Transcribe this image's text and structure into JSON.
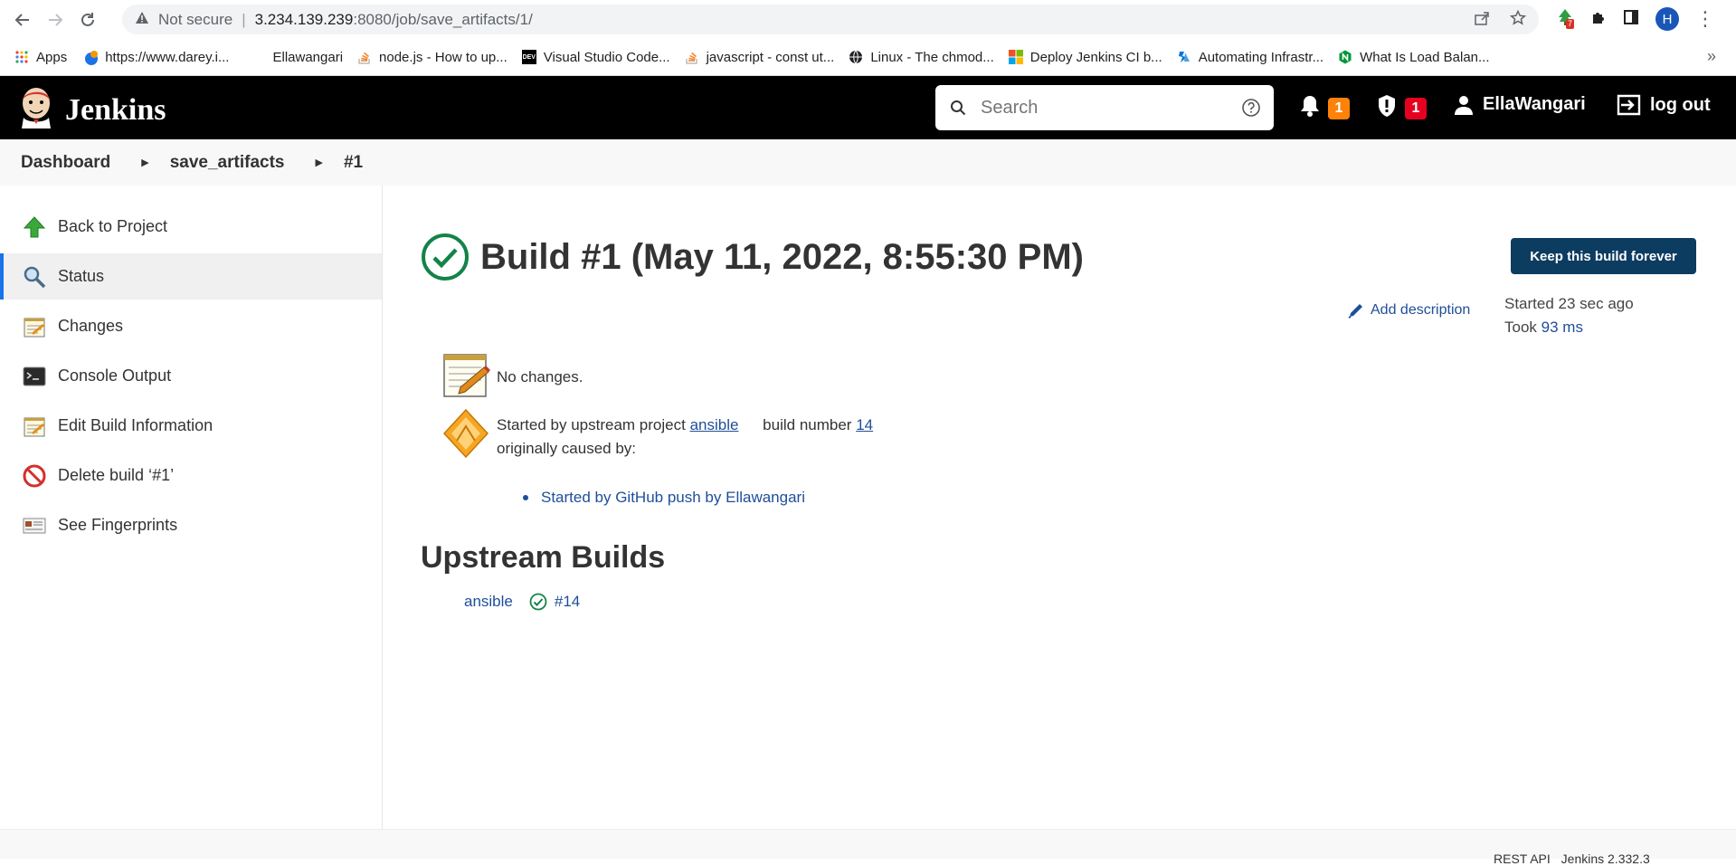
{
  "browser": {
    "security_label": "Not secure",
    "url_host": "3.234.139.239",
    "url_rest": ":8080/job/save_artifacts/1/",
    "extension_badge": "7",
    "profile_initial": "H"
  },
  "bookmarks": [
    {
      "label": "Apps",
      "icon": "apps-grid-icon"
    },
    {
      "label": "https://www.darey.i...",
      "icon": "darey-icon"
    },
    {
      "label": "Ellawangari",
      "icon": "blank-page-icon"
    },
    {
      "label": "node.js - How to up...",
      "icon": "stackoverflow-icon"
    },
    {
      "label": "Visual Studio Code...",
      "icon": "dev-icon"
    },
    {
      "label": "javascript - const ut...",
      "icon": "stackoverflow-icon"
    },
    {
      "label": "Linux - The chmod...",
      "icon": "globe-icon"
    },
    {
      "label": "Deploy Jenkins CI b...",
      "icon": "microsoft-icon"
    },
    {
      "label": "Automating Infrastr...",
      "icon": "azure-icon"
    },
    {
      "label": "What Is Load Balan...",
      "icon": "nginx-icon"
    }
  ],
  "header": {
    "logo_text": "Jenkins",
    "search_placeholder": "Search",
    "notifications_count": "1",
    "security_count": "1",
    "username": "EllaWangari",
    "logout_label": "log out"
  },
  "breadcrumb": {
    "items": [
      "Dashboard",
      "save_artifacts",
      "#1"
    ]
  },
  "sidepanel": {
    "tasks": [
      {
        "label": "Back to Project",
        "icon": "up-arrow-icon"
      },
      {
        "label": "Status",
        "icon": "magnifier-icon",
        "active": true
      },
      {
        "label": "Changes",
        "icon": "notepad-icon"
      },
      {
        "label": "Console Output",
        "icon": "terminal-icon"
      },
      {
        "label": "Edit Build Information",
        "icon": "notepad-icon"
      },
      {
        "label": "Delete build ‘#1’",
        "icon": "no-entry-icon"
      },
      {
        "label": "See Fingerprints",
        "icon": "fingerprint-card-icon"
      }
    ]
  },
  "main": {
    "title": "Build #1 (May 11, 2022, 8:55:30 PM)",
    "keep_button": "Keep this build forever",
    "add_description": "Add description",
    "started_ago": "Started 23 sec ago",
    "took_label": "Took",
    "took_value": "93 ms",
    "no_changes": "No changes.",
    "cause_prefix": "Started by upstream project",
    "cause_project": "ansible",
    "cause_build_label": "build number",
    "cause_build_number": "14",
    "caused_by": "originally caused by:",
    "github_push": "Started by GitHub push by Ellawangari",
    "upstream_heading": "Upstream Builds",
    "upstream_project": "ansible",
    "upstream_build": "#14"
  },
  "footer": {
    "rest_api": "REST API",
    "version": "Jenkins 2.332.3"
  },
  "colors": {
    "jenkins_header": "#000000",
    "keep_button": "#0d3c61",
    "success_green": "#138347",
    "link_blue": "#1f4e99",
    "warning_badge": "#fe820a",
    "danger_badge": "#e6001f"
  }
}
